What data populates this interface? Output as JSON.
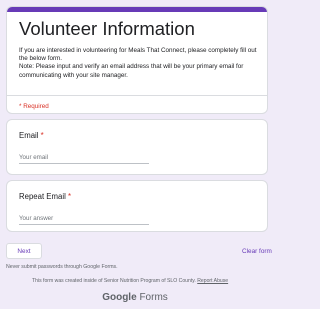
{
  "header": {
    "title": "Volunteer Information",
    "description_line1": "If you are interested in volunteering for Meals That Connect, please completely fill out the below form.",
    "description_line2": "Note: Please input and verify an email address that will be your primary email for communicating with your site manager.",
    "required_note": "* Required"
  },
  "questions": [
    {
      "label": "Email",
      "required_mark": "*",
      "placeholder": "Your email"
    },
    {
      "label": "Repeat Email",
      "required_mark": "*",
      "placeholder": "Your answer"
    }
  ],
  "actions": {
    "next_label": "Next",
    "clear_label": "Clear form"
  },
  "footer": {
    "password_warning": "Never submit passwords through Google Forms.",
    "created_note": "This form was created inside of Senior Nutrition Program of SLO County.",
    "report_abuse": "Report Abuse",
    "logo_google": "Google",
    "logo_forms": "Forms"
  },
  "colors": {
    "accent": "#673ab7",
    "background": "#f0ebf8",
    "required": "#d93025"
  }
}
